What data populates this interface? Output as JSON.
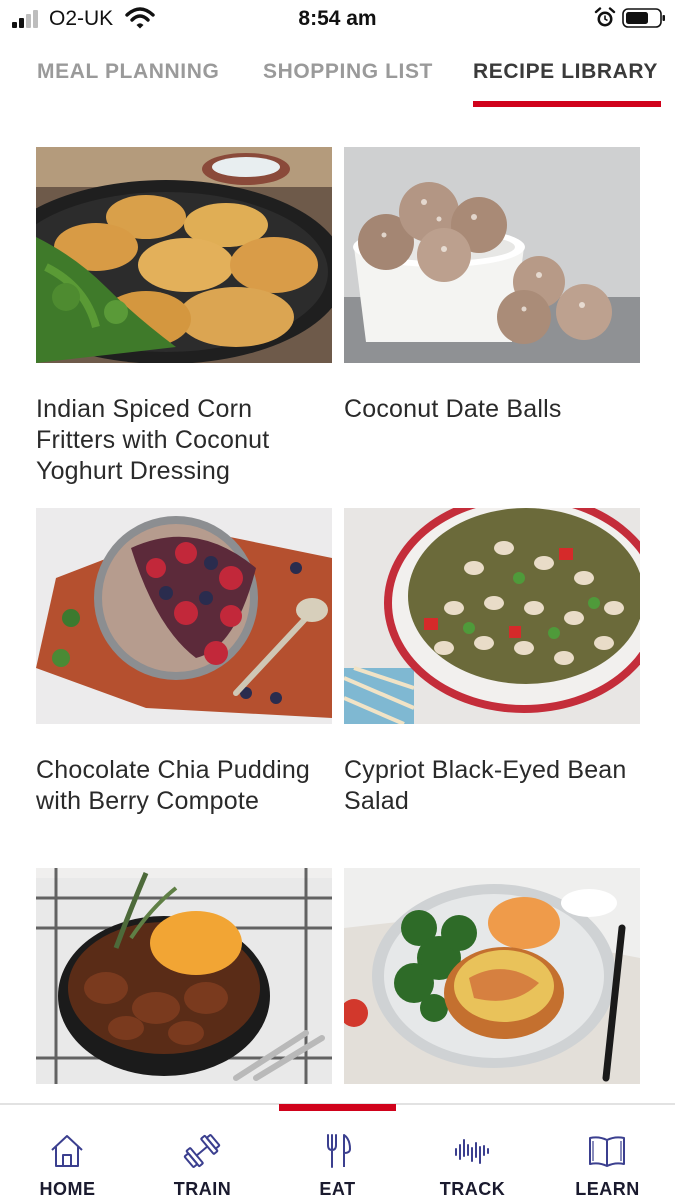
{
  "status_bar": {
    "carrier": "O2-UK",
    "time": "8:54 am"
  },
  "tabs": [
    {
      "label": "MEAL PLANNING",
      "active": false
    },
    {
      "label": "SHOPPING LIST",
      "active": false
    },
    {
      "label": "RECIPE LIBRARY",
      "active": true
    }
  ],
  "recipes": [
    {
      "title": "Indian Spiced Corn Fritters with Coconut Yoghurt Dressing"
    },
    {
      "title": "Coconut Date Balls"
    },
    {
      "title": "Chocolate Chia Pudding with Berry Compote"
    },
    {
      "title": "Cypriot Black-Eyed Bean Salad"
    },
    {
      "title": ""
    },
    {
      "title": ""
    }
  ],
  "bottom_nav": [
    {
      "label": "HOME",
      "icon": "home-icon",
      "active": false
    },
    {
      "label": "TRAIN",
      "icon": "dumbbell-icon",
      "active": false
    },
    {
      "label": "EAT",
      "icon": "cutlery-icon",
      "active": true
    },
    {
      "label": "TRACK",
      "icon": "activity-icon",
      "active": false
    },
    {
      "label": "LEARN",
      "icon": "book-icon",
      "active": false
    }
  ],
  "colors": {
    "accent": "#d0021b",
    "nav_icon": "#3b3f8f"
  }
}
